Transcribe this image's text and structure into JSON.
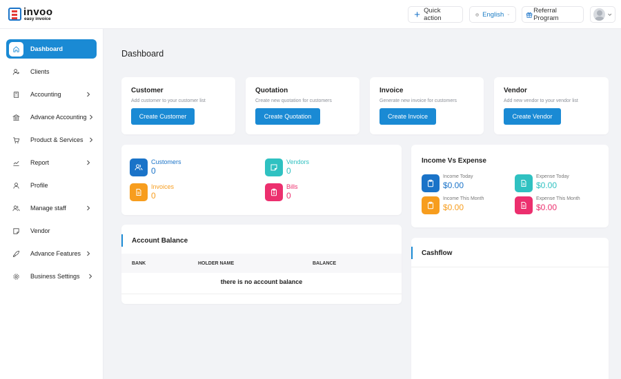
{
  "header": {
    "logo_text": "invoo",
    "logo_sub": "easy invoice",
    "quick_action": "Quick action",
    "language": "English",
    "referral": "Referral Program"
  },
  "sidebar": {
    "items": [
      {
        "label": "Dashboard",
        "icon": "home-icon",
        "active": true,
        "has_children": false
      },
      {
        "label": "Clients",
        "icon": "add-user-icon",
        "has_children": false
      },
      {
        "label": "Accounting",
        "icon": "calculator-icon",
        "has_children": true
      },
      {
        "label": "Advance Accounting",
        "icon": "bank-icon",
        "has_children": true
      },
      {
        "label": "Product & Services",
        "icon": "cart-icon",
        "has_children": true
      },
      {
        "label": "Report",
        "icon": "chart-icon",
        "has_children": true
      },
      {
        "label": "Profile",
        "icon": "user-icon",
        "has_children": false
      },
      {
        "label": "Manage staff",
        "icon": "users-icon",
        "has_children": true
      },
      {
        "label": "Vendor",
        "icon": "note-icon",
        "has_children": false
      },
      {
        "label": "Advance Features",
        "icon": "rocket-icon",
        "has_children": true
      },
      {
        "label": "Business Settings",
        "icon": "gear-icon",
        "has_children": true
      }
    ]
  },
  "main": {
    "title": "Dashboard",
    "quick_cards": [
      {
        "title": "Customer",
        "desc": "Add customer to your customer list",
        "button": "Create Customer"
      },
      {
        "title": "Quotation",
        "desc": "Create new quotation for customers",
        "button": "Create Quotation"
      },
      {
        "title": "Invoice",
        "desc": "Generate new invoice for customers",
        "button": "Create Invoice"
      },
      {
        "title": "Vendor",
        "desc": "Add new vendor to your vendor list",
        "button": "Create Vendor"
      }
    ],
    "stats": [
      {
        "label": "Customers",
        "value": "0",
        "color": "#1a73c8",
        "icon": "users-icon"
      },
      {
        "label": "Vendors",
        "value": "0",
        "color": "#2fc1c1",
        "icon": "note-icon"
      },
      {
        "label": "Invoices",
        "value": "0",
        "color": "#f79d1e",
        "icon": "document-icon"
      },
      {
        "label": "Bills",
        "value": "0",
        "color": "#ec2f6e",
        "icon": "clipboard-icon"
      }
    ],
    "income_expense": {
      "title": "Income Vs Expense",
      "items": [
        {
          "label": "Income Today",
          "value": "$0.00",
          "color": "#1a73c8",
          "icon": "clipboard-icon"
        },
        {
          "label": "Expense Today",
          "value": "$0.00",
          "color": "#2fc1c1",
          "icon": "document-icon"
        },
        {
          "label": "Income This Month",
          "value": "$0.00",
          "color": "#f79d1e",
          "icon": "clipboard-icon"
        },
        {
          "label": "Expense This Month",
          "value": "$0.00",
          "color": "#ec2f6e",
          "icon": "document-icon"
        }
      ]
    },
    "account_balance": {
      "title": "Account Balance",
      "columns": [
        "BANK",
        "HOLDER NAME",
        "BALANCE"
      ],
      "empty_text": "there is no account balance"
    },
    "cashflow": {
      "title": "Cashflow"
    }
  }
}
